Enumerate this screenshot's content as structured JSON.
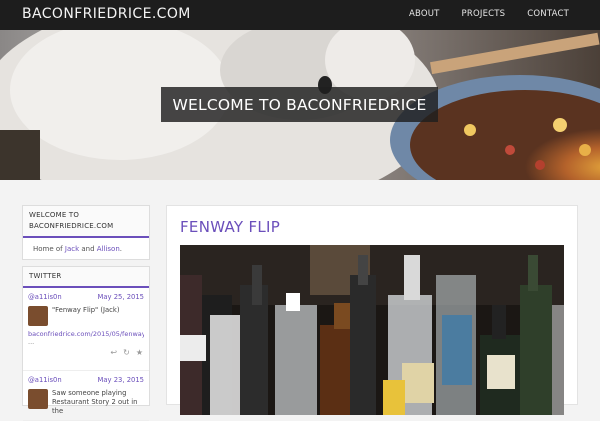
{
  "site": {
    "brand": "BACONFRIEDRICE.COM",
    "nav": [
      "ABOUT",
      "PROJECTS",
      "CONTACT"
    ]
  },
  "hero": {
    "title": "WELCOME TO BACONFRIEDRICE"
  },
  "sidebar": {
    "welcome": {
      "title": "WELCOME TO BACONFRIEDRICE.COM",
      "text_prefix": "Home of ",
      "person1": "Jack",
      "conj": " and ",
      "person2": "Allison",
      "suffix": "."
    },
    "twitter": {
      "title": "TWITTER",
      "tweets": [
        {
          "user": "@a11is0n",
          "date": "May 25, 2015",
          "text": "\"Fenway Flip\" (Jack)",
          "link": "baconfriedrice.com/2015/05/fenway",
          "ellipsis": "..."
        },
        {
          "user": "@a11is0n",
          "date": "May 23, 2015",
          "text": "Saw someone playing Restaurant Story 2 out in the"
        }
      ]
    }
  },
  "post": {
    "title": "FENWAY FLIP"
  },
  "colors": {
    "accent": "#6b4fbb",
    "nav_bg": "#1d1d1d"
  }
}
